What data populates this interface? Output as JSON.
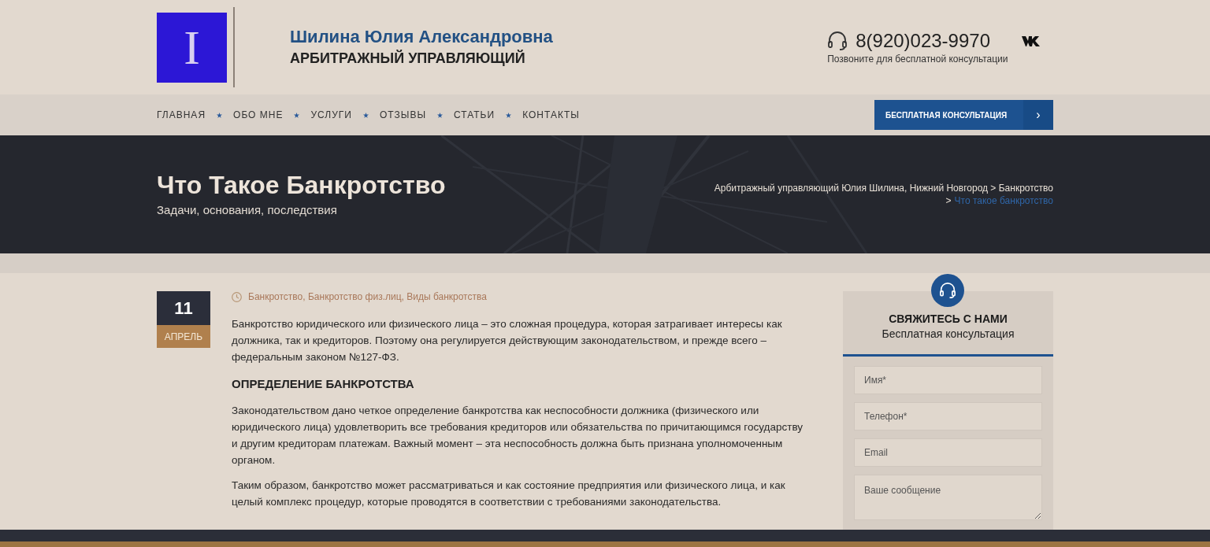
{
  "header": {
    "logo_letter": "I",
    "name": "Шилина Юлия Александровна",
    "role": "АРБИТРАЖНЫЙ УПРАВЛЯЮЩИЙ",
    "phone": "8(920)023-9970",
    "phone_note": "Позвоните для бесплатной консультации"
  },
  "nav": {
    "items": [
      {
        "label": "ГЛАВНАЯ"
      },
      {
        "label": "ОБО МНЕ"
      },
      {
        "label": "УСЛУГИ"
      },
      {
        "label": "ОТЗЫВЫ"
      },
      {
        "label": "СТАТЬИ"
      },
      {
        "label": "КОНТАКТЫ"
      }
    ],
    "cta": "БЕСПЛАТНАЯ КОНСУЛЬТАЦИЯ",
    "cta_arrow": "›"
  },
  "hero": {
    "title": "Что Такое Банкротство",
    "subtitle": "Задачи, основания, последствия",
    "breadcrumb_path": "Арбитражный управляющий Юлия Шилина, Нижний Новгород > Банкротство",
    "breadcrumb_sep": ">",
    "breadcrumb_current": "Что такое банкротство"
  },
  "article": {
    "day": "11",
    "month": "АПРЕЛЬ",
    "categories": "Банкротство, Банкротство физ.лиц, Виды банкротства",
    "blocks": [
      {
        "kind": "paragraph",
        "text": "Банкротство юридического или физического лица – это сложная процедура, которая затрагивает интересы как должника, так и кредиторов. Поэтому она регулируется действующим законодательством, и прежде всего – федеральным законом №127-ФЗ."
      },
      {
        "kind": "heading",
        "text": "ОПРЕДЕЛЕНИЕ БАНКРОТСТВА"
      },
      {
        "kind": "paragraph",
        "text": "Законодательством дано четкое определение банкротства как неспособности должника (физического или юридического лица) удовлетворить все требования кредиторов или обязательства по причитающимся государству и другим кредиторам платежам. Важный момент – эта неспособность должна быть признана уполномоченным органом."
      },
      {
        "kind": "paragraph",
        "text": "Таким образом, банкротство может рассматриваться и как состояние предприятия или физического лица, и как целый комплекс процедур, которые проводятся в соответствии с требованиями законодательства."
      }
    ]
  },
  "contact_form": {
    "title": "СВЯЖИТЕСЬ С НАМИ",
    "subtitle": "Бесплатная консультация",
    "fields": [
      {
        "kind": "input",
        "placeholder": "Имя*"
      },
      {
        "kind": "input",
        "placeholder": "Телефон*"
      },
      {
        "kind": "input",
        "placeholder": "Email"
      },
      {
        "kind": "textarea",
        "placeholder": "Ваше сообщение"
      }
    ]
  }
}
